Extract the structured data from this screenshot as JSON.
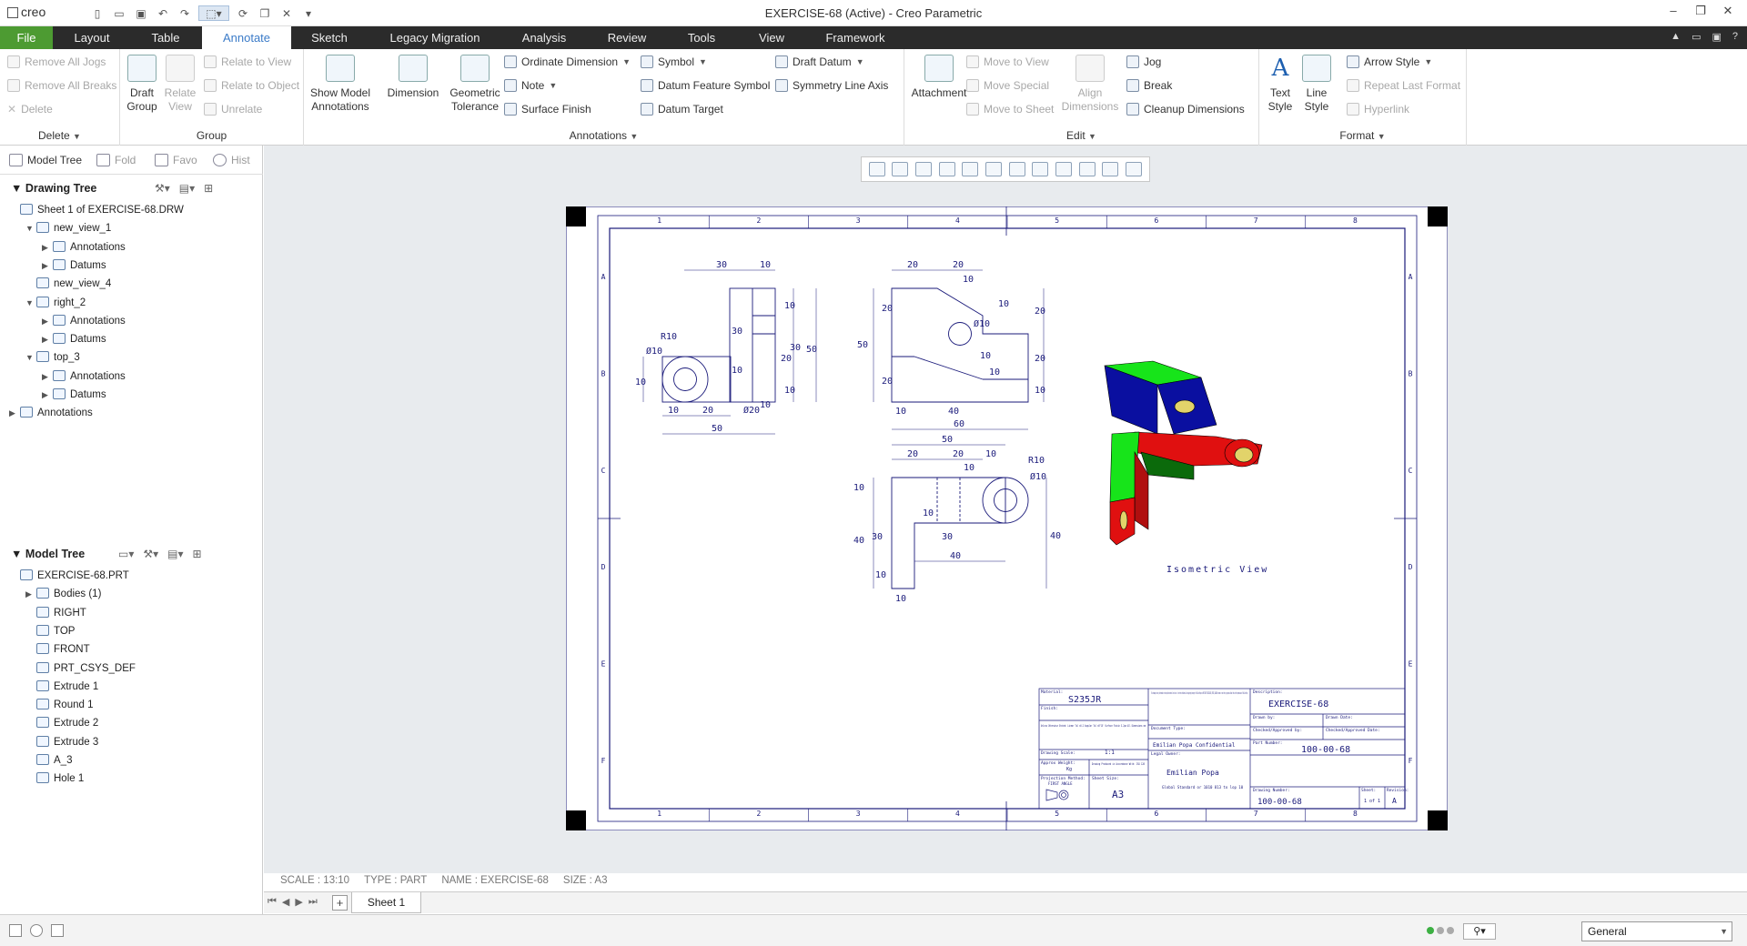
{
  "app": {
    "name": "creo",
    "window_title": "EXERCISE-68 (Active) - Creo Parametric"
  },
  "window_controls": {
    "minimize": "–",
    "restore": "❐",
    "close": "✕"
  },
  "tabs": [
    "File",
    "Layout",
    "Table",
    "Annotate",
    "Sketch",
    "Legacy Migration",
    "Analysis",
    "Review",
    "Tools",
    "View",
    "Framework"
  ],
  "active_tab": "Annotate",
  "ribbon": {
    "delete": {
      "items": [
        "Remove All Jogs",
        "Remove All Breaks",
        "Delete"
      ],
      "label": "Delete"
    },
    "group": {
      "draft_group": "Draft\nGroup",
      "relate_view": "Relate\nView",
      "relate_to_view": "Relate to View",
      "relate_to_object": "Relate to Object",
      "unrelate": "Unrelate",
      "label": "Group"
    },
    "annotations": {
      "show_model": "Show Model\nAnnotations",
      "dimension": "Dimension",
      "geometric_tolerance": "Geometric\nTolerance",
      "ordinate_dimension": "Ordinate Dimension",
      "note": "Note",
      "surface_finish": "Surface Finish",
      "symbol": "Symbol",
      "datum_feature_symbol": "Datum Feature Symbol",
      "datum_target": "Datum Target",
      "draft_datum": "Draft Datum",
      "symmetry_line_axis": "Symmetry Line Axis",
      "label": "Annotations"
    },
    "edit": {
      "attachment": "Attachment",
      "move_to_view": "Move to View",
      "move_special": "Move Special",
      "move_to_sheet": "Move to Sheet",
      "align_dimensions": "Align\nDimensions",
      "jog": "Jog",
      "break": "Break",
      "cleanup_dimensions": "Cleanup Dimensions",
      "label": "Edit"
    },
    "format": {
      "text_style": "Text\nStyle",
      "line_style": "Line\nStyle",
      "arrow_style": "Arrow Style",
      "repeat_last_format": "Repeat Last Format",
      "hyperlink": "Hyperlink",
      "label": "Format"
    }
  },
  "nav_tabs": [
    "Model Tree",
    "Fold",
    "Favo",
    "Hist"
  ],
  "drawing_tree": {
    "title": "Drawing Tree",
    "nodes": [
      {
        "label": "Sheet 1 of EXERCISE-68.DRW",
        "level": 0,
        "toggle": ""
      },
      {
        "label": "new_view_1",
        "level": 1,
        "toggle": "▼"
      },
      {
        "label": "Annotations",
        "level": 2,
        "toggle": "▶"
      },
      {
        "label": "Datums",
        "level": 2,
        "toggle": "▶"
      },
      {
        "label": "new_view_4",
        "level": 1,
        "toggle": ""
      },
      {
        "label": "right_2",
        "level": 1,
        "toggle": "▼"
      },
      {
        "label": "Annotations",
        "level": 2,
        "toggle": "▶"
      },
      {
        "label": "Datums",
        "level": 2,
        "toggle": "▶"
      },
      {
        "label": "top_3",
        "level": 1,
        "toggle": "▼"
      },
      {
        "label": "Annotations",
        "level": 2,
        "toggle": "▶"
      },
      {
        "label": "Datums",
        "level": 2,
        "toggle": "▶"
      },
      {
        "label": "Annotations",
        "level": 0,
        "toggle": "▶"
      }
    ]
  },
  "model_tree": {
    "title": "Model Tree",
    "nodes": [
      {
        "label": "EXERCISE-68.PRT",
        "level": 0,
        "toggle": ""
      },
      {
        "label": "Bodies (1)",
        "level": 1,
        "toggle": "▶"
      },
      {
        "label": "RIGHT",
        "level": 1,
        "toggle": ""
      },
      {
        "label": "TOP",
        "level": 1,
        "toggle": ""
      },
      {
        "label": "FRONT",
        "level": 1,
        "toggle": ""
      },
      {
        "label": "PRT_CSYS_DEF",
        "level": 1,
        "toggle": ""
      },
      {
        "label": "Extrude 1",
        "level": 1,
        "toggle": ""
      },
      {
        "label": "Round 1",
        "level": 1,
        "toggle": ""
      },
      {
        "label": "Extrude 2",
        "level": 1,
        "toggle": ""
      },
      {
        "label": "Extrude 3",
        "level": 1,
        "toggle": ""
      },
      {
        "label": "A_3",
        "level": 1,
        "toggle": ""
      },
      {
        "label": "Hole 1",
        "level": 1,
        "toggle": ""
      }
    ]
  },
  "drawing": {
    "zone_numbers": [
      "1",
      "2",
      "3",
      "4",
      "5",
      "6",
      "7",
      "8"
    ],
    "zone_letters": [
      "A",
      "B",
      "C",
      "D",
      "E",
      "F"
    ],
    "isometric_label": "Isometric View",
    "front_dims": [
      "30",
      "10",
      "R10",
      "Ø10",
      "10",
      "10",
      "20",
      "50",
      "Ø20",
      "10",
      "10",
      "30",
      "10",
      "20",
      "30",
      "50",
      "10"
    ],
    "right_dims": [
      "20",
      "20",
      "10",
      "Ø10",
      "10",
      "20",
      "20",
      "10",
      "50",
      "20",
      "20",
      "10",
      "10",
      "10",
      "40",
      "60"
    ],
    "top_dims": [
      "50",
      "20",
      "20",
      "10",
      "10",
      "R10",
      "Ø10",
      "10",
      "10",
      "30",
      "40",
      "40",
      "30",
      "10",
      "40",
      "10"
    ],
    "title_block": {
      "material_label": "Material:",
      "material": "S235JR",
      "finish_label": "Finish:",
      "unless_note": "Unless Otherwise Stated: Linear Tol ±0.2 Angular Tol ±0°15' Surface Finish 3.2µm All Dimensions mm",
      "drawing_scale_label": "Drawing Scale:",
      "drawing_scale": "1:1",
      "weight_label": "Approx Weight:",
      "weight": "Kg",
      "produced_note": "Drawing Produced in Accordance With: ISO 128",
      "projection_label": "Projection Method:",
      "projection": "FIRST ANGLE",
      "sheet_size_label": "Sheet Size:",
      "sheet_size": "A3",
      "confidential_note": "This drawing and any information or descriptive material set out on it are the confidential and copyright property of Emilian Popa and MUST NOT BE DISCLOSED, COPIED, LOANED or made or used for any purpose without the written permission of Emilian Popa",
      "doc_type_label": "Document Type:",
      "doc_type": "Emilian Popa Confidential",
      "legal_owner_label": "Legal Owner:",
      "legal_owner": "Emilian Popa",
      "owner_note": "Global Standard or 1010 813 to lop 10",
      "description_label": "Description:",
      "description": "EXERCISE-68",
      "drawn_by_label": "Drawn by:",
      "drawn_date_label": "Drawn Date:",
      "checked_label": "Checked/Approved by:",
      "checked_date_label": "Checked/Approved Date:",
      "part_number_label": "Part Number:",
      "part_number": "100-00-68",
      "drawing_number_label": "Drawing Number:",
      "drawing_number": "100-00-68",
      "sheet_label": "Sheet:",
      "sheet": "1 of 1",
      "revision_label": "Revision:",
      "revision": "A"
    }
  },
  "status_line": [
    "SCALE : 13:10",
    "TYPE : PART",
    "NAME : EXERCISE-68",
    "SIZE : A3"
  ],
  "sheet_tabs": [
    "Sheet 1"
  ],
  "filter": {
    "value": "General"
  },
  "colors": {
    "file_tab": "#4d9b32",
    "dark_bar": "#2b2b2b",
    "active_tab_text": "#3b7bc8",
    "drawing_line": "#1a1a7a",
    "iso_green": "#17e41a",
    "iso_blue": "#0a0fa0",
    "iso_red": "#e01010"
  }
}
